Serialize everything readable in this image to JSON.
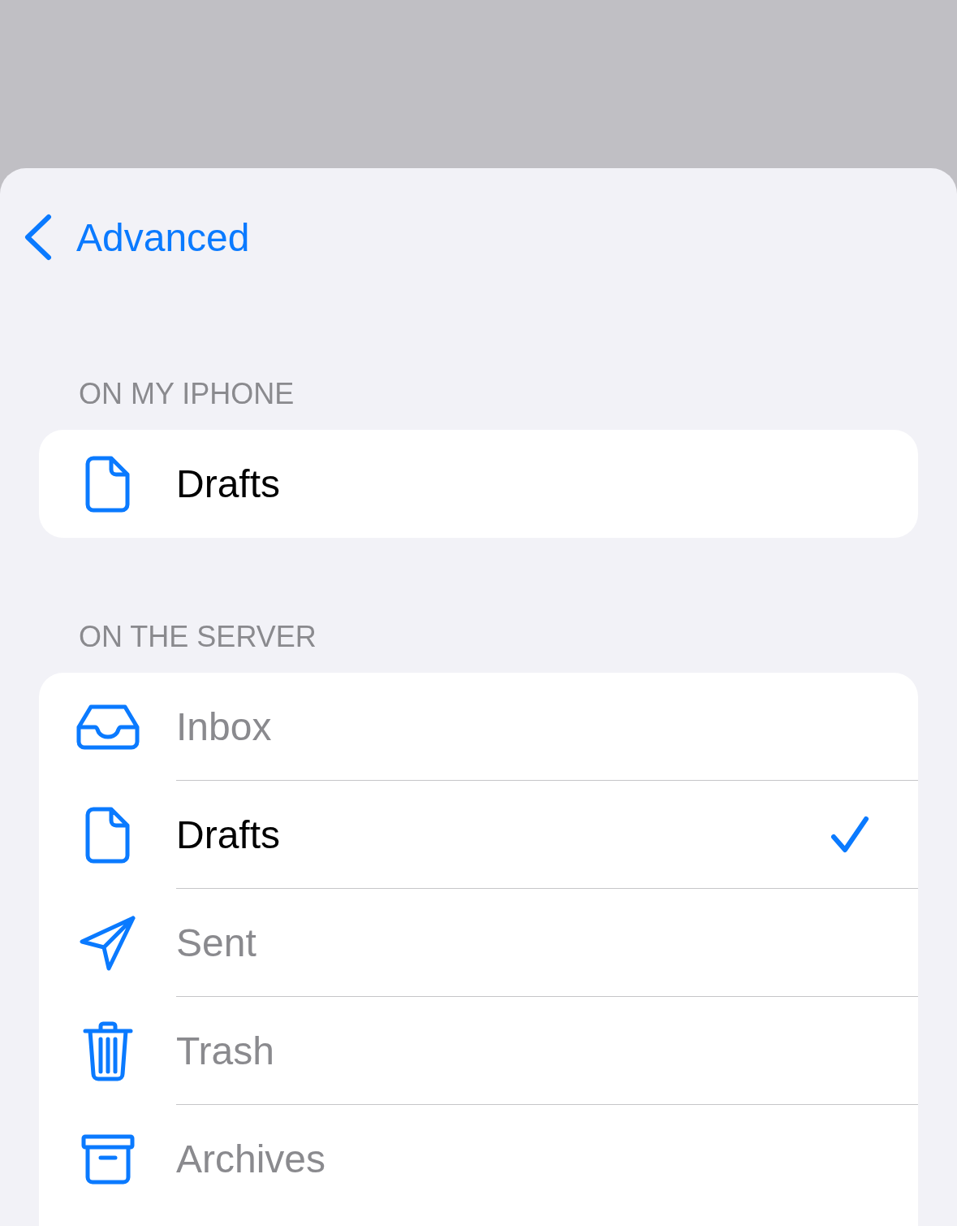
{
  "back_button": {
    "label": "Advanced"
  },
  "sections": [
    {
      "header": "ON MY IPHONE",
      "items": [
        {
          "kind": "document",
          "label": "Drafts",
          "disabled": false,
          "selected": false
        }
      ]
    },
    {
      "header": "ON THE SERVER",
      "items": [
        {
          "kind": "inbox",
          "label": "Inbox",
          "disabled": true,
          "selected": false
        },
        {
          "kind": "document",
          "label": "Drafts",
          "disabled": false,
          "selected": true
        },
        {
          "kind": "sent",
          "label": "Sent",
          "disabled": true,
          "selected": false
        },
        {
          "kind": "trash",
          "label": "Trash",
          "disabled": true,
          "selected": false
        },
        {
          "kind": "archive",
          "label": "Archives",
          "disabled": true,
          "selected": false
        }
      ]
    }
  ]
}
